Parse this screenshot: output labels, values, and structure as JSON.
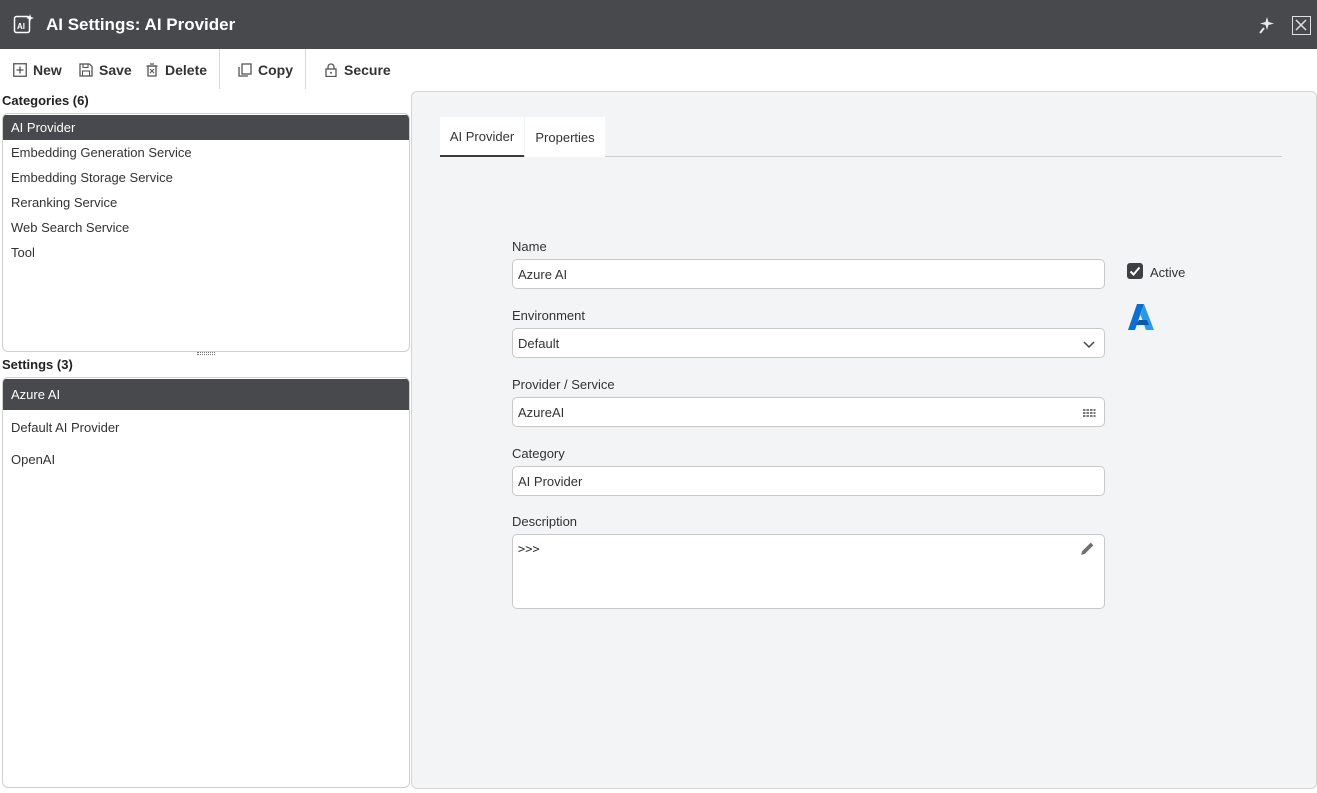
{
  "window": {
    "title": "AI Settings: AI Provider"
  },
  "toolbar": {
    "new_label": "New",
    "save_label": "Save",
    "delete_label": "Delete",
    "copy_label": "Copy",
    "secure_label": "Secure"
  },
  "categories": {
    "header": "Categories (6)",
    "items": [
      {
        "label": "AI Provider"
      },
      {
        "label": "Embedding Generation Service"
      },
      {
        "label": "Embedding Storage Service"
      },
      {
        "label": "Reranking Service"
      },
      {
        "label": "Web Search Service"
      },
      {
        "label": "Tool"
      }
    ]
  },
  "settings": {
    "header": "Settings (3)",
    "items": [
      {
        "label": "Azure AI"
      },
      {
        "label": "Default AI Provider"
      },
      {
        "label": "OpenAI"
      }
    ]
  },
  "tabs": [
    {
      "label": "AI Provider"
    },
    {
      "label": "Properties"
    }
  ],
  "form": {
    "name_label": "Name",
    "name_value": "Azure AI",
    "active_label": "Active",
    "environment_label": "Environment",
    "environment_value": "Default",
    "provider_label": "Provider / Service",
    "provider_value": "AzureAI",
    "category_label": "Category",
    "category_value": "AI Provider",
    "description_label": "Description",
    "description_value": ">>>"
  },
  "colors": {
    "titlebar": "#48494c",
    "selection": "#48494c",
    "azure_blue": "#0a6fd1"
  }
}
